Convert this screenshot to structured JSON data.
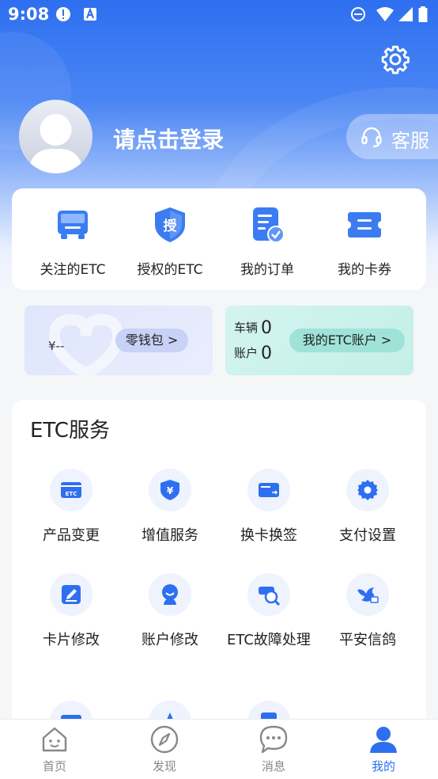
{
  "status_bar": {
    "time": "9:08"
  },
  "profile": {
    "login_prompt": "请点击登录",
    "service_label": "客服"
  },
  "quick_actions": [
    {
      "label": "关注的ETC",
      "icon": "truck-icon"
    },
    {
      "label": "授权的ETC",
      "icon": "authorize-shield-icon"
    },
    {
      "label": "我的订单",
      "icon": "order-icon"
    },
    {
      "label": "我的卡券",
      "icon": "coupon-icon"
    }
  ],
  "wallet": {
    "amount": "¥--",
    "button_label": "零钱包 >"
  },
  "etc_account": {
    "vehicles_label": "车辆",
    "vehicles_count": "0",
    "account_label": "账户",
    "account_count": "0",
    "button_label": "我的ETC账户 >"
  },
  "etc_services": {
    "title": "ETC服务",
    "items": [
      {
        "label": "产品变更",
        "icon": "etc-card-icon"
      },
      {
        "label": "增值服务",
        "icon": "yuan-shield-icon"
      },
      {
        "label": "换卡换签",
        "icon": "card-swap-icon"
      },
      {
        "label": "支付设置",
        "icon": "gear-icon"
      },
      {
        "label": "卡片修改",
        "icon": "edit-icon"
      },
      {
        "label": "账户修改",
        "icon": "user-icon"
      },
      {
        "label": "ETC故障处理",
        "icon": "search-fault-icon"
      },
      {
        "label": "平安信鸽",
        "icon": "pigeon-icon"
      }
    ]
  },
  "tabs": [
    {
      "label": "首页",
      "icon": "home-icon",
      "active": false
    },
    {
      "label": "发现",
      "icon": "compass-icon",
      "active": false
    },
    {
      "label": "消息",
      "icon": "message-icon",
      "active": false
    },
    {
      "label": "我的",
      "icon": "profile-icon",
      "active": true
    }
  ],
  "colors": {
    "primary": "#2e6ff0",
    "accent_green": "#9fe3d8",
    "wallet_blue": "#c8d2f6"
  }
}
